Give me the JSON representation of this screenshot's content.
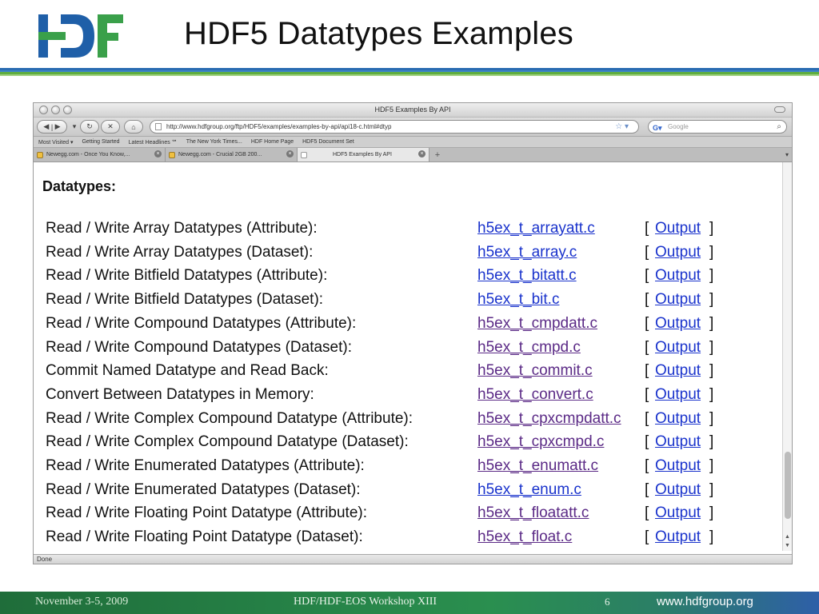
{
  "slide": {
    "title": "HDF5 Datatypes Examples",
    "logo_alt": "HDF",
    "footer": {
      "date": "November 3-5, 2009",
      "workshop": "HDF/HDF-EOS Workshop XIII",
      "page": "6",
      "site": "www.hdfgroup.org"
    },
    "colors": {
      "logo_blue": "#1f5fa8",
      "logo_green": "#3aa04a",
      "link_blue": "#1a33cc",
      "visited_purple": "#5b2a86"
    }
  },
  "browser": {
    "window_title": "HDF5 Examples By API",
    "url": "http://www.hdfgroup.org/ftp/HDF5/examples/examples-by-api/api18-c.html#dtyp",
    "search_placeholder": "Google",
    "bookmarks": [
      "Most Visited ▾",
      "Getting Started",
      "Latest Headlines ℠",
      "The New York Times...",
      "HDF Home Page",
      "HDF5 Document Set"
    ],
    "tabs": [
      {
        "label": "Newegg.com - Once You Know,...",
        "active": false
      },
      {
        "label": "Newegg.com - Crucial 2GB 200...",
        "active": false
      },
      {
        "label": "HDF5 Examples By API",
        "active": true
      }
    ],
    "status": "Done",
    "icons": {
      "back": "back-icon",
      "forward": "forward-icon",
      "reload": "reload-icon",
      "stop": "stop-icon",
      "home": "home-icon",
      "bookmark_star": "star-icon",
      "search": "search-icon"
    }
  },
  "page": {
    "heading": "Datatypes:",
    "output_label": "Output",
    "bracket_open": "[",
    "bracket_close": "]",
    "rows": [
      {
        "desc": "Read / Write Array Datatypes (Attribute):",
        "file": "h5ex_t_arrayatt.c",
        "visited": false
      },
      {
        "desc": "Read / Write Array Datatypes (Dataset):",
        "file": "h5ex_t_array.c",
        "visited": false
      },
      {
        "desc": "Read / Write Bitfield Datatypes (Attribute):",
        "file": "h5ex_t_bitatt.c",
        "visited": false
      },
      {
        "desc": "Read / Write Bitfield Datatypes (Dataset):",
        "file": "h5ex_t_bit.c",
        "visited": false
      },
      {
        "desc": "Read / Write Compound Datatypes (Attribute):",
        "file": "h5ex_t_cmpdatt.c",
        "visited": true
      },
      {
        "desc": "Read / Write Compound Datatypes (Dataset):",
        "file": "h5ex_t_cmpd.c",
        "visited": true
      },
      {
        "desc": "Commit Named Datatype and Read Back:",
        "file": "h5ex_t_commit.c",
        "visited": true
      },
      {
        "desc": "Convert Between Datatypes in Memory:",
        "file": "h5ex_t_convert.c",
        "visited": true
      },
      {
        "desc": "Read / Write Complex Compound Datatype (Attribute):",
        "file": "h5ex_t_cpxcmpdatt.c",
        "visited": true
      },
      {
        "desc": "Read / Write Complex Compound Datatype (Dataset):",
        "file": "h5ex_t_cpxcmpd.c",
        "visited": true
      },
      {
        "desc": "Read / Write Enumerated Datatypes (Attribute):",
        "file": "h5ex_t_enumatt.c",
        "visited": true
      },
      {
        "desc": "Read / Write Enumerated Datatypes (Dataset):",
        "file": "h5ex_t_enum.c",
        "visited": false
      },
      {
        "desc": "Read / Write Floating Point Datatype (Attribute):",
        "file": "h5ex_t_floatatt.c",
        "visited": true
      },
      {
        "desc": "Read / Write Floating Point Datatype (Dataset):",
        "file": "h5ex_t_float.c",
        "visited": true
      }
    ]
  }
}
